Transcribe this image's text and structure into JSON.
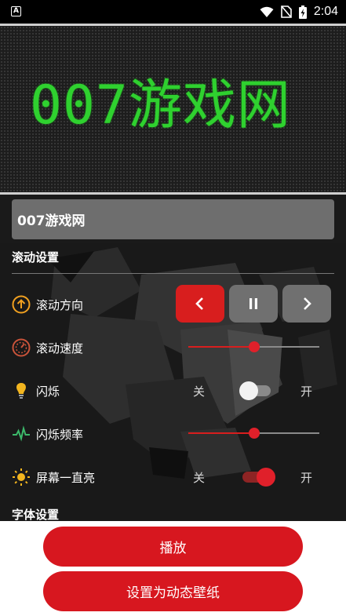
{
  "status_bar": {
    "app_icon_letter": "A",
    "time": "2:04",
    "icons": [
      "wifi-icon",
      "no-sim-icon",
      "battery-charging-icon"
    ]
  },
  "display": {
    "text": "007游戏网",
    "color": "#2fd12f"
  },
  "input": {
    "value": "007游戏网"
  },
  "scroll_settings": {
    "title": "滚动设置",
    "direction": {
      "label": "滚动方向",
      "buttons": [
        "chevron-left-icon",
        "pause-icon",
        "chevron-right-icon"
      ],
      "selected": "chevron-left-icon"
    },
    "speed": {
      "label": "滚动速度",
      "value_fraction": 0.5
    },
    "blink": {
      "label": "闪烁",
      "off_label": "关",
      "on_label": "开",
      "state": "off"
    },
    "blink_frequency": {
      "label": "闪烁频率",
      "value_fraction": 0.5
    },
    "screen_on": {
      "label": "屏幕一直亮",
      "off_label": "关",
      "on_label": "开",
      "state": "on"
    }
  },
  "font_settings": {
    "title": "字体设置"
  },
  "actions": {
    "play_label": "播放",
    "set_wallpaper_label": "设置为动态壁纸"
  },
  "colors": {
    "accent": "#d7171f",
    "led_green": "#2fd12f"
  }
}
